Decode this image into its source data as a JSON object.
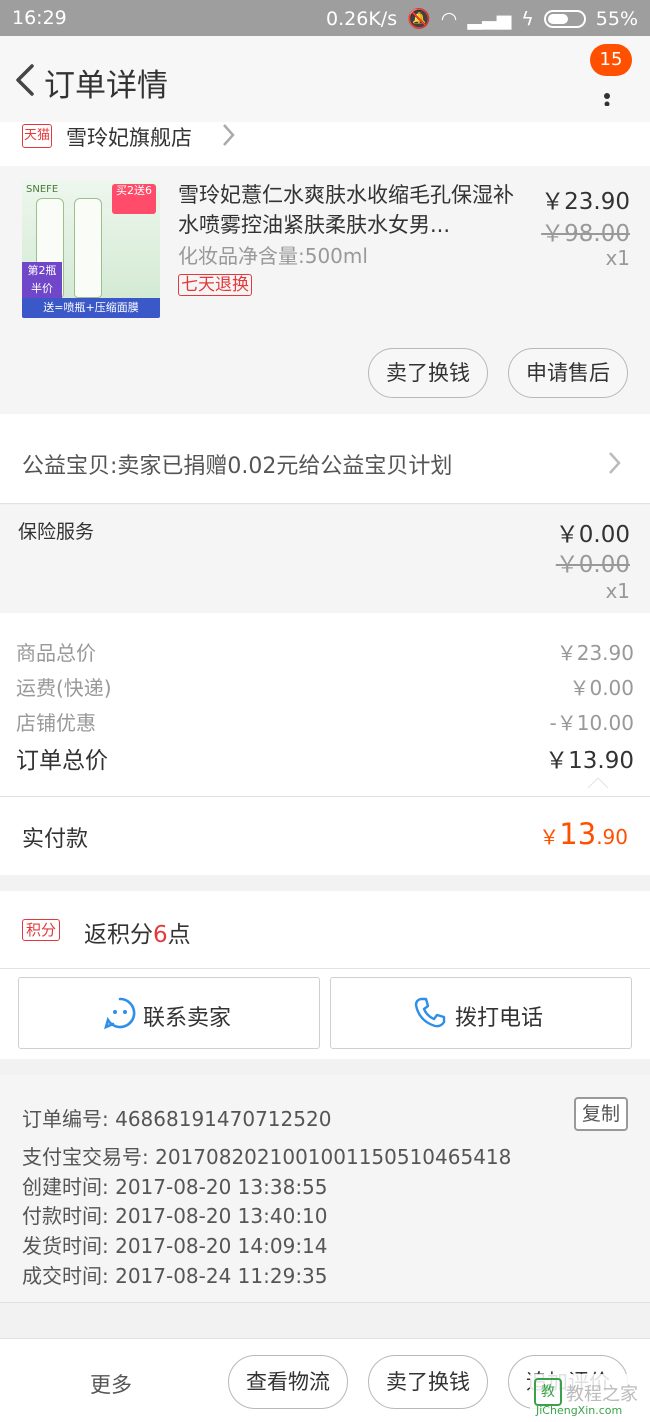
{
  "status_bar": {
    "time": "16:29",
    "speed": "0.26K/s",
    "battery": "55%"
  },
  "header": {
    "title": "订单详情",
    "badge_count": "15"
  },
  "shop": {
    "platform_tag": "天猫",
    "name": "雪玲妃旗舰店"
  },
  "product": {
    "image_texts": {
      "brand": "SNEFE",
      "promo": "买2送6",
      "half_price": "第2瓶 半价",
      "bottom_tag": "送=喷瓶+压缩面膜"
    },
    "title": "雪玲妃薏仁水爽肤水收缩毛孔保湿补水喷雾控油紧肤柔肤水女男...",
    "sku": "化妆品净含量:500ml",
    "refund_tag": "七天退换",
    "price": "￥23.90",
    "original_price": "￥98.00",
    "quantity": "x1",
    "buttons": {
      "sell": "卖了换钱",
      "after_sale": "申请售后"
    }
  },
  "charity": {
    "text": "公益宝贝:卖家已捐赠0.02元给公益宝贝计划"
  },
  "insurance": {
    "label": "保险服务",
    "price": "￥0.00",
    "original_price": "￥0.00",
    "quantity": "x1"
  },
  "summary": {
    "rows": [
      {
        "label": "商品总价",
        "value": "￥23.90"
      },
      {
        "label": "运费(快递)",
        "value": "￥0.00"
      },
      {
        "label": "店铺优惠",
        "value": "-￥10.00"
      }
    ],
    "total_label": "订单总价",
    "total_value": "￥13.90"
  },
  "paid": {
    "label": "实付款",
    "symbol": "￥",
    "integer": "13",
    "decimal": ".90"
  },
  "points": {
    "tag": "积分",
    "prefix": "返积分",
    "number": "6",
    "suffix": "点"
  },
  "contact": {
    "seller": "联系卖家",
    "phone": "拨打电话"
  },
  "order_info": {
    "copy_label": "复制",
    "rows": [
      "订单编号: 46868191470712520",
      "支付宝交易号: 2017082021001001150510465418",
      "创建时间: 2017-08-20 13:38:55",
      "付款时间: 2017-08-20 13:40:10",
      "发货时间: 2017-08-20 14:09:14",
      "成交时间: 2017-08-24 11:29:35"
    ]
  },
  "bottom_bar": {
    "more": "更多",
    "logistics": "查看物流",
    "sell": "卖了换钱",
    "review": "追加评价"
  },
  "watermark": {
    "site": "教程之家",
    "url": "JiChengXin.com"
  },
  "colors": {
    "accent": "#ff5000",
    "tmall_red": "#e4393c",
    "link_blue": "#2f8fe8"
  }
}
